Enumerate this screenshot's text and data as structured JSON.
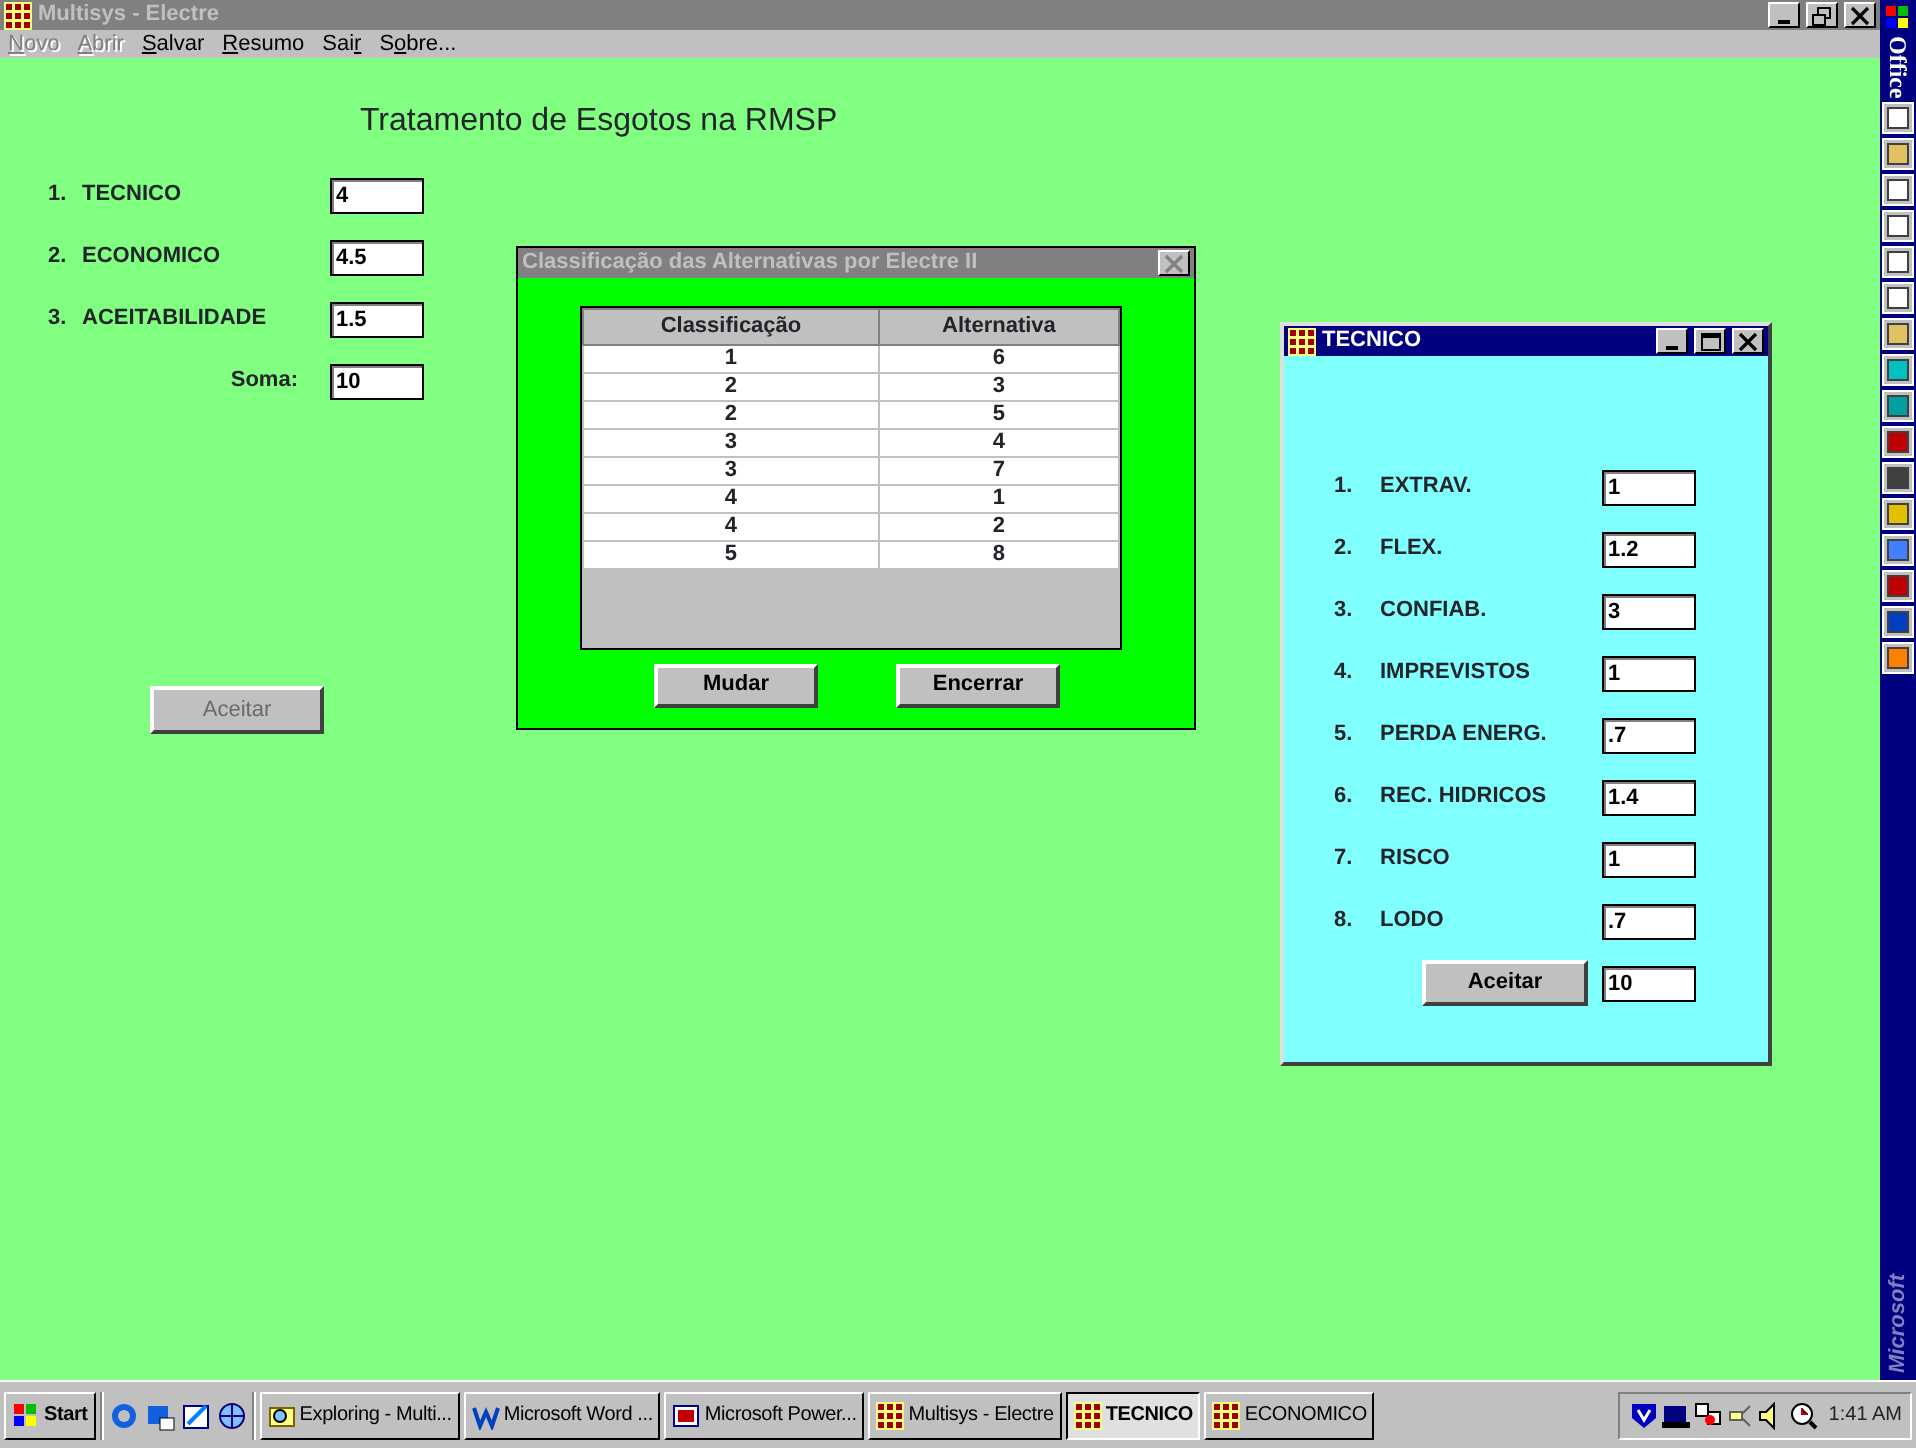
{
  "main_window": {
    "title": "Multisys - Electre",
    "active": false,
    "menu": [
      {
        "key": "N",
        "post": "ovo",
        "disabled": true
      },
      {
        "key": "A",
        "post": "brir",
        "disabled": true
      },
      {
        "key": "S",
        "post": "alvar",
        "disabled": false
      },
      {
        "key": "R",
        "post": "esumo",
        "disabled": false
      },
      {
        "pre": "Sai",
        "key": "r",
        "disabled": false
      },
      {
        "pre": "S",
        "key": "o",
        "post": "bre...",
        "disabled": false
      }
    ],
    "heading": "Tratamento de Esgotos na RMSP",
    "criteria": [
      {
        "number": "1.",
        "label": "TECNICO",
        "value": "4"
      },
      {
        "number": "2.",
        "label": "ECONOMICO",
        "value": "4.5"
      },
      {
        "number": "3.",
        "label": "ACEITABILIDADE",
        "value": "1.5"
      }
    ],
    "sum": {
      "label": "Soma:",
      "value": "10"
    },
    "accept_button": {
      "label": "Aceitar",
      "disabled": true
    }
  },
  "ranking_dialog": {
    "title": "Classificação das Alternativas por Electre II",
    "active": false,
    "columns": [
      "Classificação",
      "Alternativa"
    ],
    "rows": [
      [
        "1",
        "6"
      ],
      [
        "2",
        "3"
      ],
      [
        "2",
        "5"
      ],
      [
        "3",
        "4"
      ],
      [
        "3",
        "7"
      ],
      [
        "4",
        "1"
      ],
      [
        "4",
        "2"
      ],
      [
        "5",
        "8"
      ]
    ],
    "buttons": [
      "Mudar",
      "Encerrar"
    ]
  },
  "tecnico_window": {
    "title": "TECNICO",
    "active": true,
    "items": [
      {
        "number": "1.",
        "label": "EXTRAV.",
        "value": "1"
      },
      {
        "number": "2.",
        "label": "FLEX.",
        "value": "1.2"
      },
      {
        "number": "3.",
        "label": "CONFIAB.",
        "value": "3"
      },
      {
        "number": "4.",
        "label": "IMPREVISTOS",
        "value": "1"
      },
      {
        "number": "5.",
        "label": "PERDA ENERG.",
        "value": ".7"
      },
      {
        "number": "6.",
        "label": "REC. HIDRICOS",
        "value": "1.4"
      },
      {
        "number": "7.",
        "label": "RISCO",
        "value": "1"
      },
      {
        "number": "8.",
        "label": "LODO",
        "value": ".7"
      }
    ],
    "accept_button": {
      "label": "Aceitar",
      "disabled": false
    },
    "total": "10"
  },
  "office_bar": {
    "title": "Office",
    "footer": "Microsoft"
  },
  "taskbar": {
    "start": "Start",
    "tasks": [
      {
        "label": "Exploring - Multi...",
        "kind": "explorer",
        "selected": false
      },
      {
        "label": "Microsoft Word ...",
        "kind": "word",
        "selected": false
      },
      {
        "label": "Microsoft Power...",
        "kind": "powerpoint",
        "selected": false
      },
      {
        "label": "Multisys - Electre",
        "kind": "app",
        "selected": false
      },
      {
        "label": "TECNICO",
        "kind": "app",
        "selected": true
      },
      {
        "label": "ECONOMICO",
        "kind": "app",
        "selected": false
      }
    ],
    "clock": "1:41 AM"
  }
}
